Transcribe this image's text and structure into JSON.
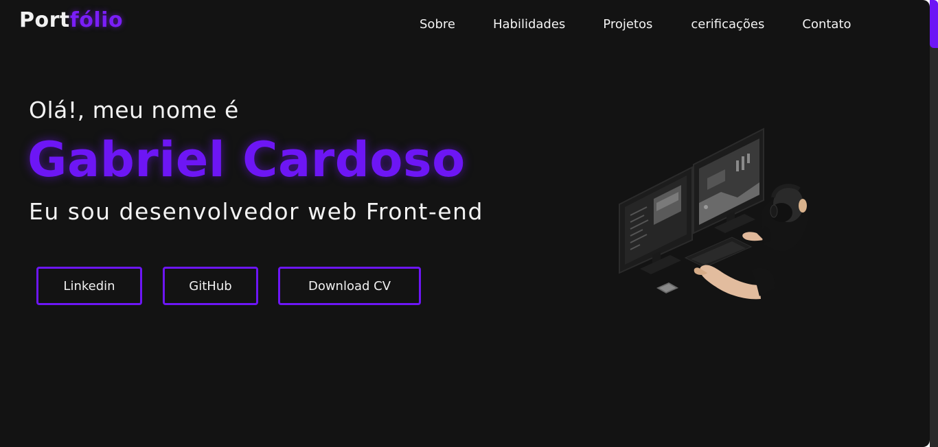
{
  "header": {
    "logo_part1": "Port",
    "logo_part2": "fólio",
    "nav": [
      {
        "label": "Sobre"
      },
      {
        "label": "Habilidades"
      },
      {
        "label": "Projetos"
      },
      {
        "label": "cerificações"
      },
      {
        "label": "Contato"
      }
    ]
  },
  "hero": {
    "greeting": "Olá!, meu nome é",
    "name": "Gabriel Cardoso",
    "role": "Eu sou desenvolvedor web Front-end",
    "buttons": [
      {
        "label": "Linkedin"
      },
      {
        "label": "GitHub"
      },
      {
        "label": "Download CV"
      }
    ],
    "illustration": "developer-at-computer-illustration"
  },
  "colors": {
    "background": "#131313",
    "accent": "#6d16f5",
    "text": "#f3f3f3"
  }
}
